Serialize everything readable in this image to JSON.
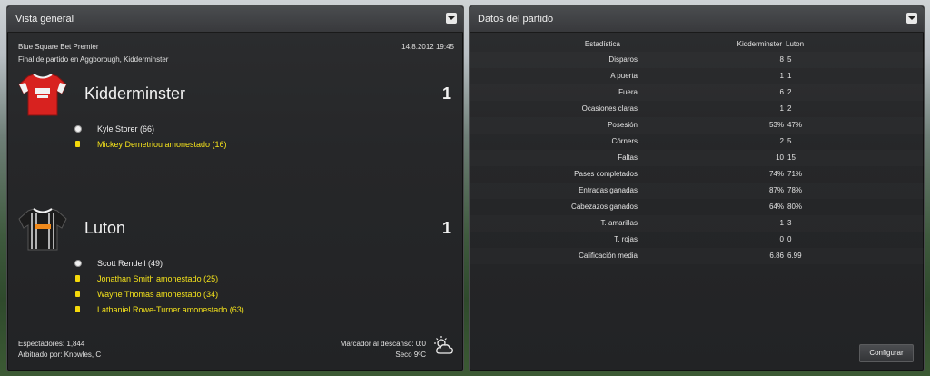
{
  "overview": {
    "title": "Vista general",
    "competition": "Blue Square Bet Premier",
    "datetime": "14.8.2012 19:45",
    "venue": "Final de partido en Aggborough, Kidderminster",
    "home": {
      "name": "Kidderminster",
      "score": "1",
      "events": [
        {
          "type": "goal",
          "text": "Kyle Storer (66)"
        },
        {
          "type": "yellow",
          "text": "Mickey Demetriou amonestado (16)"
        }
      ]
    },
    "away": {
      "name": "Luton",
      "score": "1",
      "events": [
        {
          "type": "goal",
          "text": "Scott Rendell (49)"
        },
        {
          "type": "yellow",
          "text": "Jonathan Smith amonestado (25)"
        },
        {
          "type": "yellow",
          "text": "Wayne Thomas amonestado (34)"
        },
        {
          "type": "yellow",
          "text": "Lathaniel Rowe-Turner amonestado (63)"
        }
      ]
    },
    "attendance": "Espectadores: 1,844",
    "referee": "Arbitrado por: Knowles, C",
    "halftime": "Marcador al descanso: 0:0",
    "weather": "Seco 9ºC"
  },
  "stats": {
    "title": "Datos del partido",
    "header": {
      "label": "Estadística",
      "home": "Kidderminster",
      "away": "Luton"
    },
    "rows": [
      {
        "label": "Disparos",
        "home": "8",
        "away": "5"
      },
      {
        "label": "A puerta",
        "home": "1",
        "away": "1"
      },
      {
        "label": "Fuera",
        "home": "6",
        "away": "2"
      },
      {
        "label": "Ocasiones claras",
        "home": "1",
        "away": "2"
      },
      {
        "label": "Posesión",
        "home": "53%",
        "away": "47%"
      },
      {
        "label": "Córners",
        "home": "2",
        "away": "5"
      },
      {
        "label": "Faltas",
        "home": "10",
        "away": "15"
      },
      {
        "label": "Pases completados",
        "home": "74%",
        "away": "71%"
      },
      {
        "label": "Entradas ganadas",
        "home": "87%",
        "away": "78%"
      },
      {
        "label": "Cabezazos ganados",
        "home": "64%",
        "away": "80%"
      },
      {
        "label": "T. amarillas",
        "home": "1",
        "away": "3"
      },
      {
        "label": "T. rojas",
        "home": "0",
        "away": "0"
      },
      {
        "label": "Calificación media",
        "home": "6.86",
        "away": "6.99"
      }
    ],
    "configure_label": "Configurar"
  },
  "colors": {
    "yellow_card": "#f5d90a",
    "event_yellow_text": "#f3e11b"
  }
}
